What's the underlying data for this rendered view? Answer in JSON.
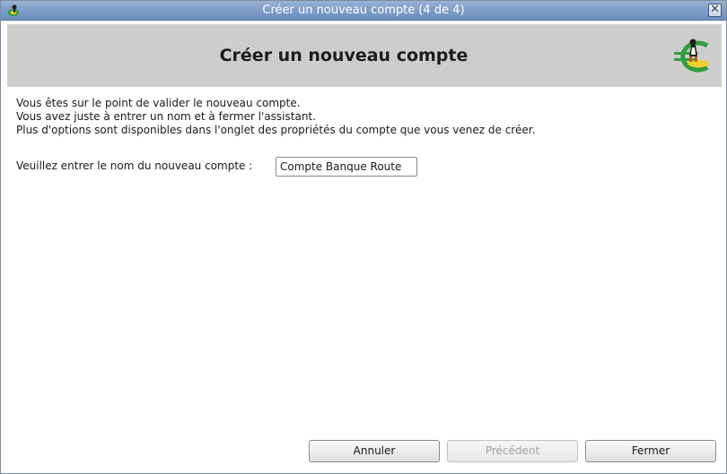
{
  "window": {
    "title": "Créer un nouveau compte (4 de 4)",
    "close_glyph": "✕",
    "app_icon": "grisbi-app-icon"
  },
  "header": {
    "title": "Créer un nouveau compte",
    "logo": "grisbi-logo-icon"
  },
  "content": {
    "lines": [
      "Vous êtes sur le point de valider le nouveau compte.",
      "Vous avez juste à entrer un nom et à fermer l'assistant.",
      "Plus d'options sont disponibles dans l'onglet des propriétés du compte que vous venez de créer."
    ],
    "name_label": "Veuillez entrer le nom du nouveau compte :",
    "name_value": "Compte Banque Route"
  },
  "buttons": {
    "cancel": "Annuler",
    "previous": "Précédent",
    "close": "Fermer"
  },
  "colors": {
    "titlebar": "#7f9fc9",
    "header_bg": "#cdcdcb",
    "logo_green": "#2e9e3e",
    "logo_yellow": "#f2d21b"
  }
}
